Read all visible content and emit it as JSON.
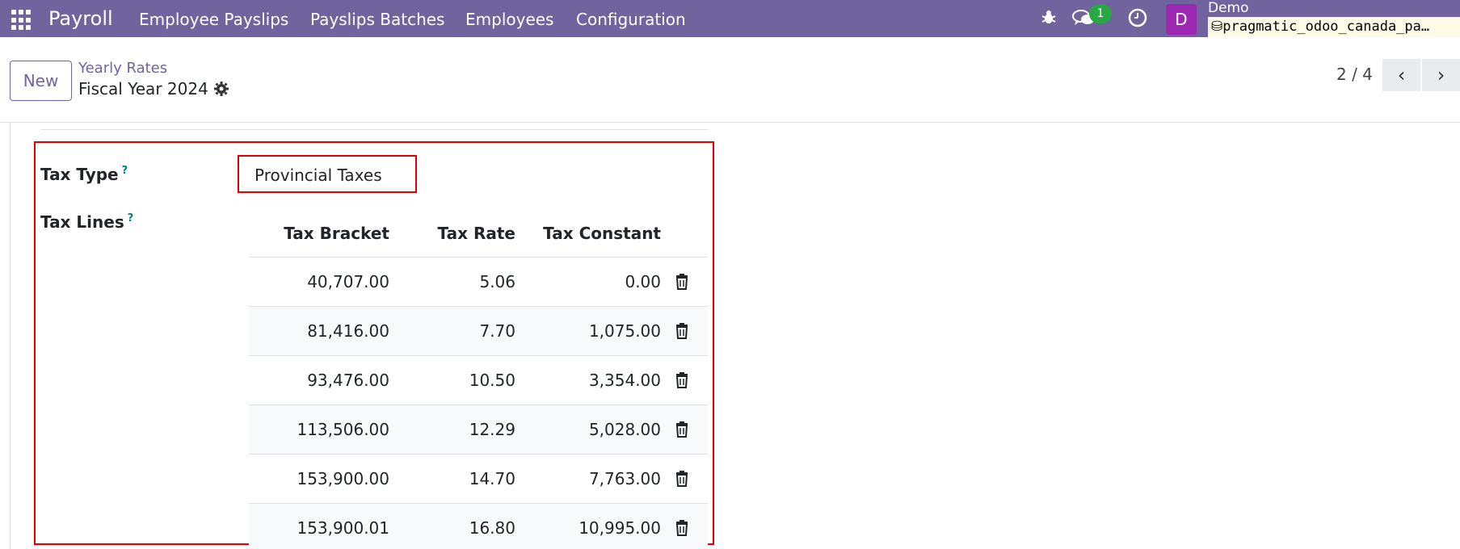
{
  "navbar": {
    "brand": "Payroll",
    "menu": [
      "Employee Payslips",
      "Payslips Batches",
      "Employees",
      "Configuration"
    ],
    "messages_badge": "1",
    "avatar_letter": "D",
    "user_name": "Demo",
    "database": "pragmatic_odoo_canada_pa…",
    "colors": {
      "navbar": "#71639e",
      "badge": "#28a745",
      "avatar": "#9c27b0"
    }
  },
  "control_panel": {
    "new_label": "New",
    "breadcrumb": "Yearly Rates",
    "record_title": "Fiscal Year 2024",
    "pager": "2 / 4",
    "prev_label": "‹",
    "next_label": "›"
  },
  "form": {
    "tax_type_label": "Tax Type",
    "tax_type_help": "?",
    "tax_type_value": "Provincial Taxes",
    "tax_lines_label": "Tax Lines",
    "tax_lines_help": "?",
    "columns": [
      "Tax Bracket",
      "Tax Rate",
      "Tax Constant"
    ],
    "rows": [
      {
        "bracket": "40,707.00",
        "rate": "5.06",
        "constant": "0.00"
      },
      {
        "bracket": "81,416.00",
        "rate": "7.70",
        "constant": "1,075.00"
      },
      {
        "bracket": "93,476.00",
        "rate": "10.50",
        "constant": "3,354.00"
      },
      {
        "bracket": "113,506.00",
        "rate": "12.29",
        "constant": "5,028.00"
      },
      {
        "bracket": "153,900.00",
        "rate": "14.70",
        "constant": "7,763.00"
      },
      {
        "bracket": "153,900.01",
        "rate": "16.80",
        "constant": "10,995.00"
      }
    ],
    "highlight_color": "#e00000"
  }
}
